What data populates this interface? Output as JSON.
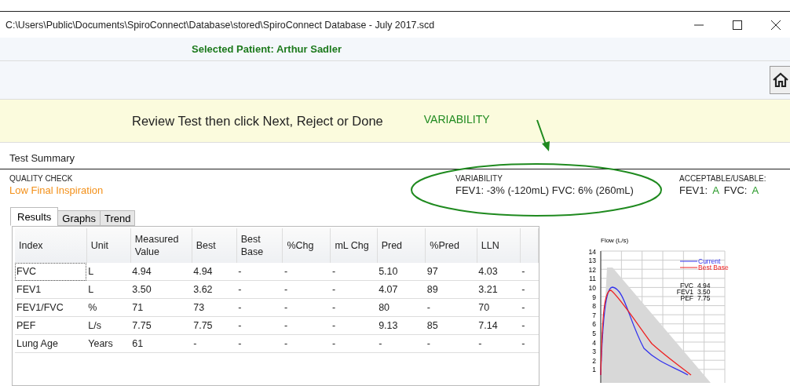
{
  "window": {
    "title": "C:\\Users\\Public\\Documents\\SpiroConnect\\Database\\stored\\SpiroConnect Database - July 2017.scd"
  },
  "patient_banner": "Selected Patient: Arthur Sadler",
  "instruction": "Review Test then click Next, Reject or Done",
  "callout": {
    "label": "VARIABILITY"
  },
  "section_title": "Test Summary",
  "quality_check": {
    "label": "QUALITY CHECK",
    "value": "Low Final Inspiration"
  },
  "variability": {
    "label": "VARIABILITY",
    "value": "FEV1: -3% (-120mL) FVC: 6% (260mL)"
  },
  "acceptable": {
    "label": "ACCEPTABLE/USABLE:",
    "items": [
      {
        "name": "FEV1:",
        "grade": "A"
      },
      {
        "name": "FVC:",
        "grade": "A"
      }
    ]
  },
  "tabs": [
    {
      "label": "Results",
      "selected": true
    },
    {
      "label": "Graphs",
      "selected": false
    },
    {
      "label": "Trend",
      "selected": false
    }
  ],
  "table": {
    "columns": [
      "Index",
      "Unit",
      "Measured Value",
      "Best",
      "Best Base",
      "%Chg",
      "mL Chg",
      "Pred",
      "%Pred",
      "LLN"
    ],
    "rows": [
      {
        "cells": [
          "FVC",
          "L",
          "4.94",
          "4.94",
          "-",
          "-",
          "-",
          "5.10",
          "97",
          "4.03",
          "-"
        ],
        "focused": true
      },
      {
        "cells": [
          "FEV1",
          "L",
          "3.50",
          "3.62",
          "-",
          "-",
          "-",
          "4.07",
          "89",
          "3.21",
          "-"
        ],
        "focused": false
      },
      {
        "cells": [
          "FEV1/FVC",
          "%",
          "71",
          "73",
          "-",
          "-",
          "-",
          "80",
          "-",
          "70",
          "-"
        ],
        "focused": false
      },
      {
        "cells": [
          "PEF",
          "L/s",
          "7.75",
          "7.75",
          "-",
          "-",
          "-",
          "9.13",
          "85",
          "7.14",
          "-"
        ],
        "focused": false
      },
      {
        "cells": [
          "Lung Age",
          "Years",
          "61",
          "-",
          "-",
          "-",
          "-",
          "-",
          "-",
          "-",
          "-"
        ],
        "focused": false
      }
    ]
  },
  "flow_chart": {
    "ylabel": "Flow (L/s)",
    "y_ticks": [
      "14",
      "13",
      "12",
      "11",
      "10",
      "9",
      "8",
      "7",
      "6",
      "5",
      "4",
      "3",
      "2",
      "1"
    ],
    "legend": [
      {
        "name": "Current",
        "color": "#3333ee"
      },
      {
        "name": "Best Base",
        "color": "#ee2222"
      }
    ],
    "readings": [
      {
        "name": "FVC",
        "value": "4.94"
      },
      {
        "name": "FEV1",
        "value": "3.50"
      },
      {
        "name": "PEF",
        "value": "7.75"
      }
    ]
  }
}
